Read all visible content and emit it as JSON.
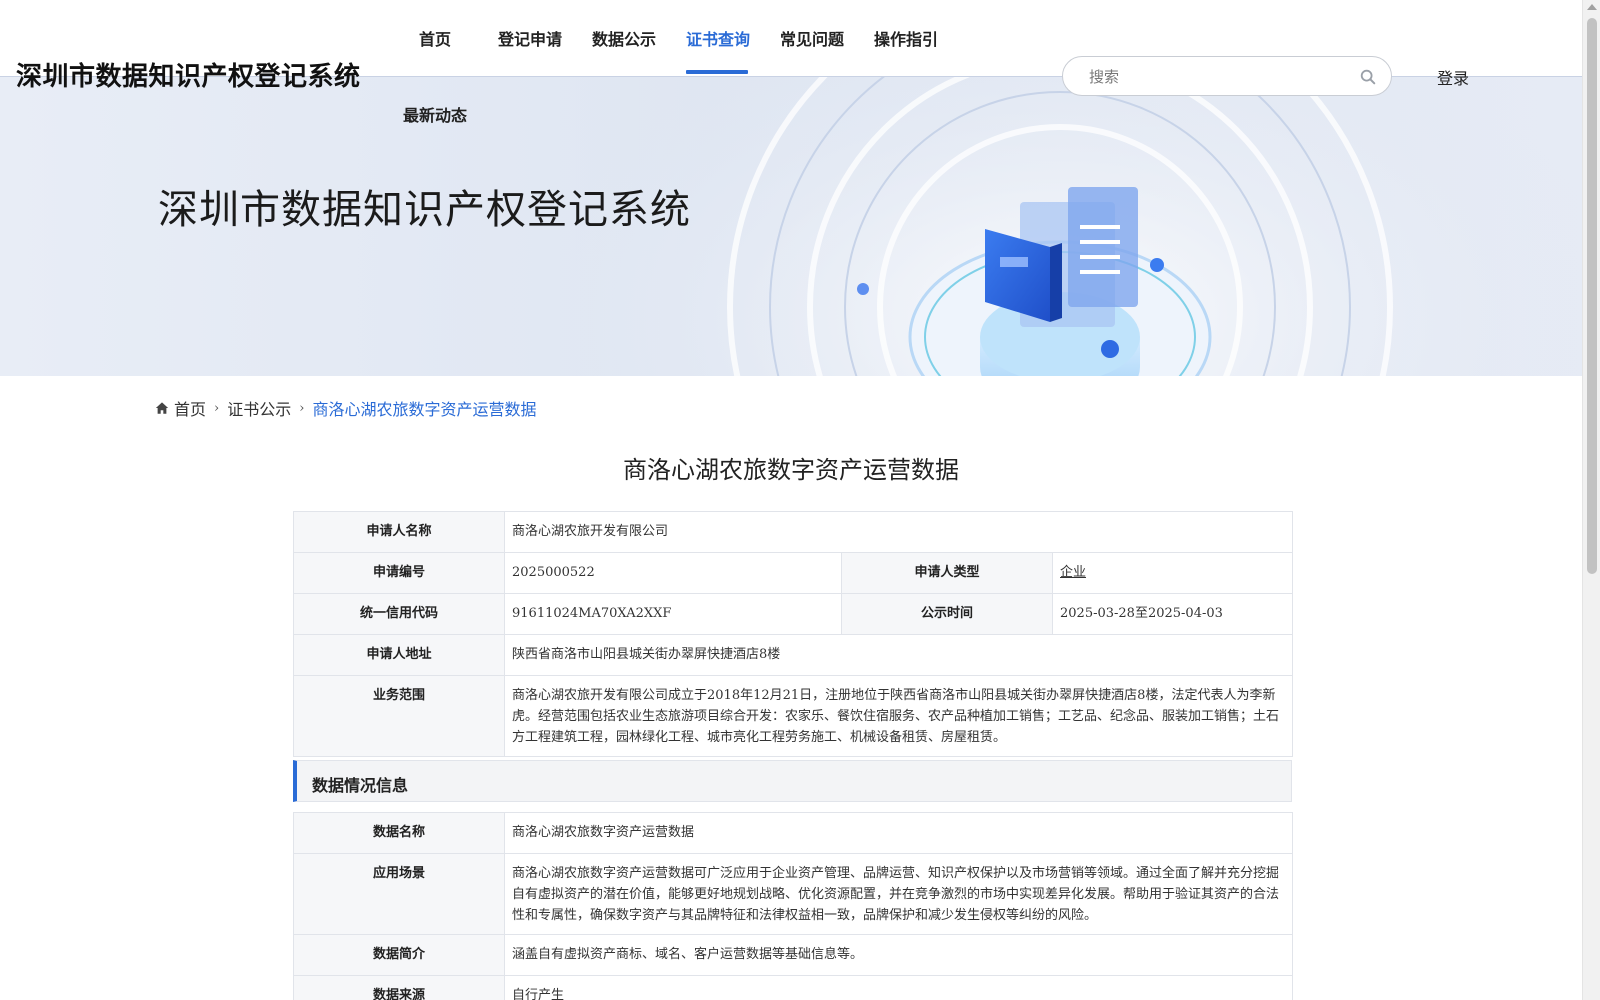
{
  "header": {
    "site_title": "深圳市数据知识产权登记系统",
    "nav": [
      {
        "label": "首页"
      },
      {
        "label": "登记申请"
      },
      {
        "label": "数据公示"
      },
      {
        "label": "证书查询",
        "active": true
      },
      {
        "label": "常见问题"
      },
      {
        "label": "操作指引"
      },
      {
        "label": "最新动态"
      }
    ],
    "search": {
      "placeholder": "搜索",
      "value": "",
      "icon": "search-icon"
    },
    "login_label": "登录",
    "accent_color": "#2a6bd6"
  },
  "banner": {
    "title": "深圳市数据知识产权登记系统"
  },
  "breadcrumb": {
    "home_icon": "home-icon",
    "items": [
      "首页",
      "证书公示",
      "商洛心湖农旅数字资产运营数据"
    ]
  },
  "page_title": "商洛心湖农旅数字资产运营数据",
  "applicant": {
    "name_label": "申请人名称",
    "name_value": "商洛心湖农旅开发有限公司",
    "number_label": "申请编号",
    "number_value": "2025000522",
    "type_label": "申请人类型",
    "type_value": "企业",
    "credit_label": "统一信用代码",
    "credit_value": "91611024MA70XA2XXF",
    "publicity_label": "公示时间",
    "publicity_value": "2025-03-28至2025-04-03",
    "address_label": "申请人地址",
    "address_value": "陕西省商洛市山阳县城关街办翠屏快捷酒店8楼",
    "scope_label": "业务范围",
    "scope_value": "商洛心湖农旅开发有限公司成立于2018年12月21日，注册地位于陕西省商洛市山阳县城关街办翠屏快捷酒店8楼，法定代表人为李新虎。经营范围包括农业生态旅游项目综合开发：农家乐、餐饮住宿服务、农产品种植加工销售；工艺品、纪念品、服装加工销售；土石方工程建筑工程，园林绿化工程、城市亮化工程劳务施工、机械设备租赁、房屋租赁。"
  },
  "data_section": {
    "header": "数据情况信息",
    "name_label": "数据名称",
    "name_value": "商洛心湖农旅数字资产运营数据",
    "scenario_label": "应用场景",
    "scenario_value": "商洛心湖农旅数字资产运营数据可广泛应用于企业资产管理、品牌运营、知识产权保护以及市场营销等领域。通过全面了解并充分挖掘自有虚拟资产的潜在价值，能够更好地规划战略、优化资源配置，并在竞争激烈的市场中实现差异化发展。帮助用于验证其资产的合法性和专属性，确保数字资产与其品牌特征和法律权益相一致，品牌保护和减少发生侵权等纠纷的风险。",
    "intro_label": "数据简介",
    "intro_value": "涵盖自有虚拟资产商标、域名、客户运营数据等基础信息等。",
    "source_label": "数据来源",
    "source_value": "自行产生"
  }
}
